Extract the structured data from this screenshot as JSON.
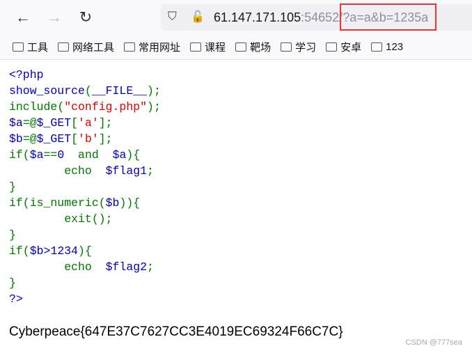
{
  "browser": {
    "url_host": "61.147.171.105",
    "url_port": ":54652/",
    "url_query": "?a=a&b=1235a",
    "highlight_color": "#ee3333"
  },
  "bookmarks": [
    "工具",
    "网络工具",
    "常用网址",
    "课程",
    "靶场",
    "学习",
    "安卓",
    "123"
  ],
  "code_lines": [
    [
      [
        "<?php",
        "b"
      ]
    ],
    [
      [
        "show_source",
        "b"
      ],
      [
        "(",
        "g"
      ],
      [
        "__FILE__",
        "b"
      ],
      [
        ");",
        "g"
      ]
    ],
    [
      [
        "include",
        "g"
      ],
      [
        "(",
        "g"
      ],
      [
        "\"config.php\"",
        "r"
      ],
      [
        ");",
        "g"
      ]
    ],
    [
      [
        "$a",
        "b"
      ],
      [
        "=@",
        "g"
      ],
      [
        "$_GET",
        "b"
      ],
      [
        "[",
        "g"
      ],
      [
        "'a'",
        "r"
      ],
      [
        "];",
        "g"
      ]
    ],
    [
      [
        "$b",
        "b"
      ],
      [
        "=@",
        "g"
      ],
      [
        "$_GET",
        "b"
      ],
      [
        "[",
        "g"
      ],
      [
        "'b'",
        "r"
      ],
      [
        "];",
        "g"
      ]
    ],
    [
      [
        "if(",
        "g"
      ],
      [
        "$a",
        "b"
      ],
      [
        "==",
        "g"
      ],
      [
        "0",
        "b"
      ],
      [
        "  and  ",
        "g"
      ],
      [
        "$a",
        "b"
      ],
      [
        "){",
        "g"
      ]
    ],
    [
      [
        "        echo  ",
        "g"
      ],
      [
        "$flag1",
        "b"
      ],
      [
        ";",
        "g"
      ]
    ],
    [
      [
        "}",
        "g"
      ]
    ],
    [
      [
        "if(is_numeric(",
        "g"
      ],
      [
        "$b",
        "b"
      ],
      [
        ")){",
        "g"
      ]
    ],
    [
      [
        "        exit();",
        "g"
      ]
    ],
    [
      [
        "}",
        "g"
      ]
    ],
    [
      [
        "if(",
        "g"
      ],
      [
        "$b",
        "b"
      ],
      [
        ">",
        "b"
      ],
      [
        "1234",
        "b"
      ],
      [
        "){",
        "g"
      ]
    ],
    [
      [
        "        echo  ",
        "g"
      ],
      [
        "$flag2",
        "b"
      ],
      [
        ";",
        "g"
      ]
    ],
    [
      [
        "}",
        "g"
      ]
    ],
    [
      [
        "?>",
        "b"
      ]
    ]
  ],
  "output": {
    "flag": "Cyberpeace{647E37C7627CC3E4019EC69324F66C7C}"
  },
  "watermark": "CSDN @777sea"
}
